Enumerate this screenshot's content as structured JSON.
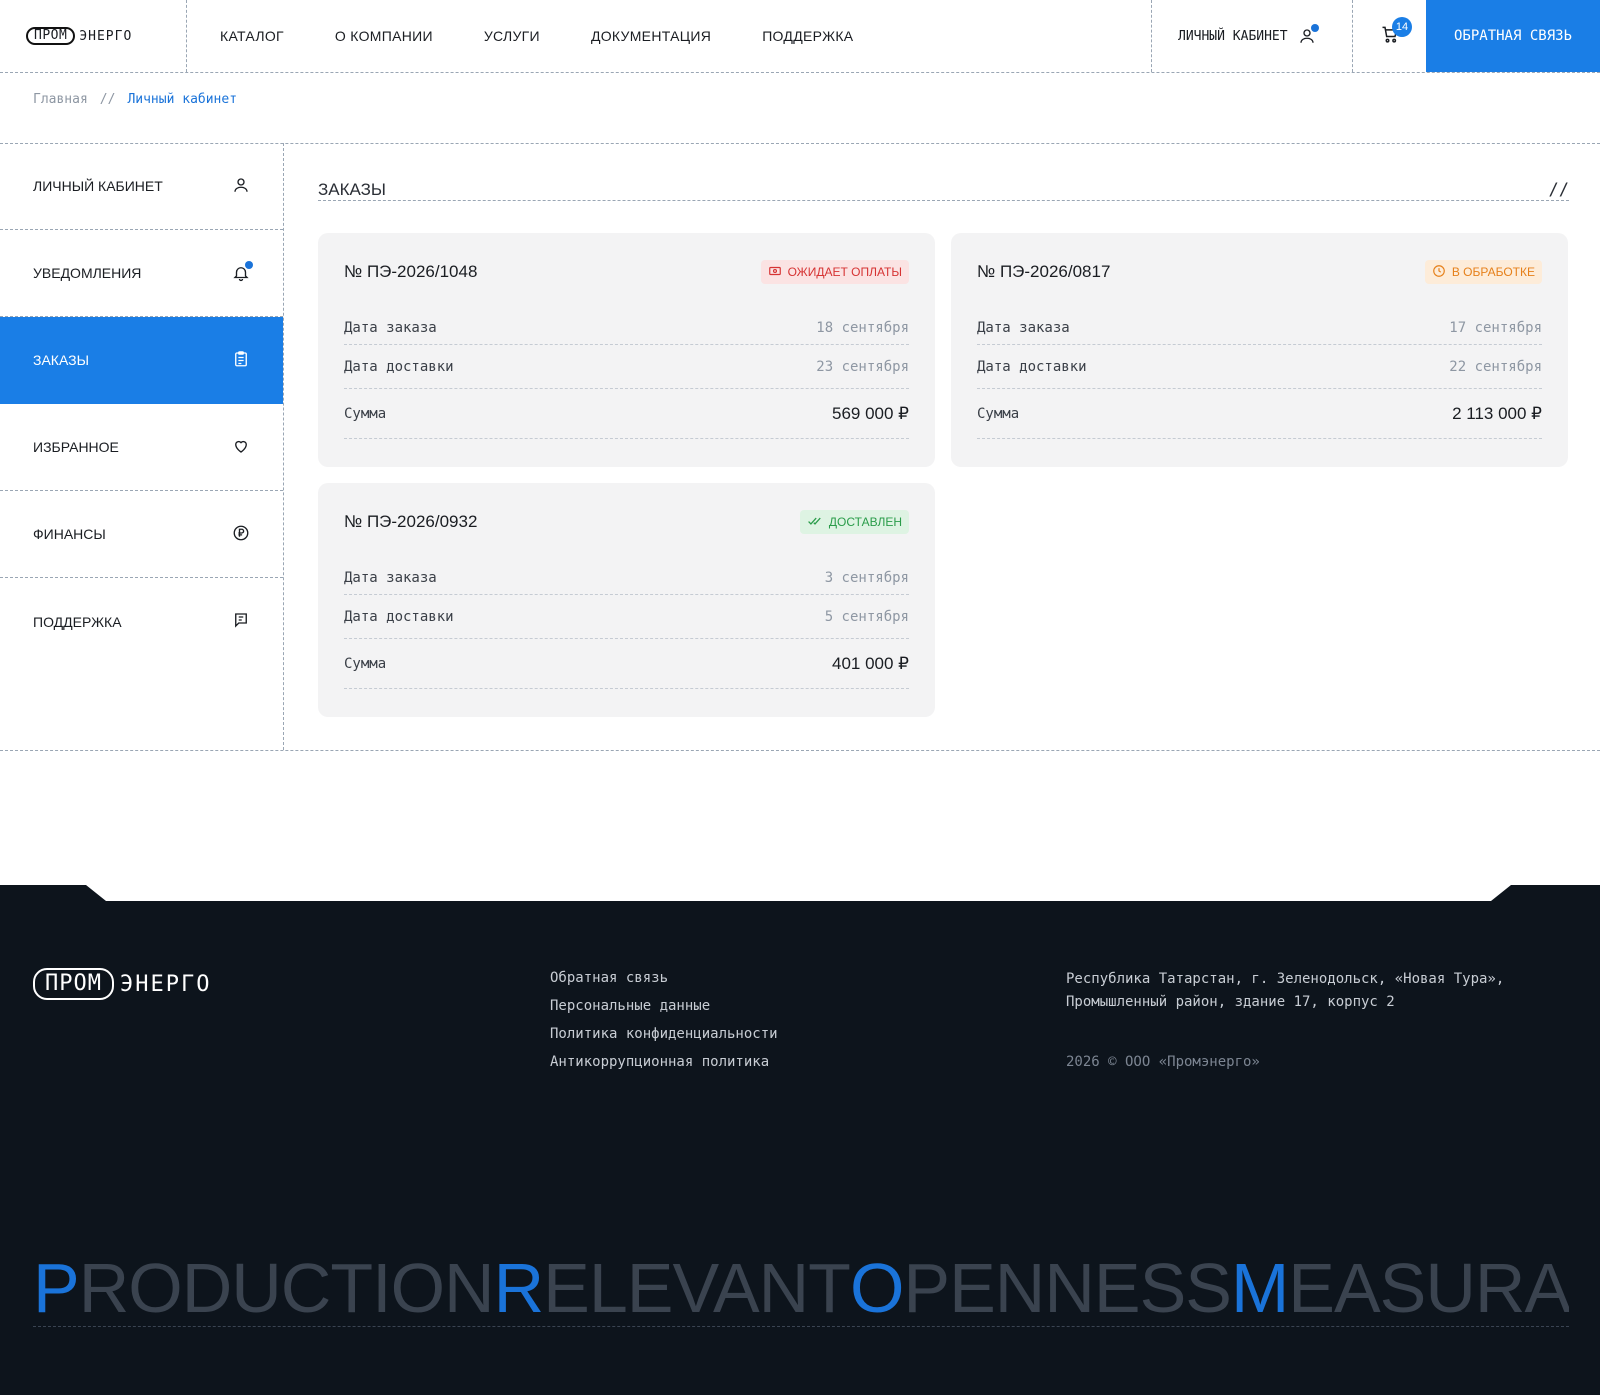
{
  "header": {
    "logo_pill": "ПРОМ",
    "logo_word": "ЭНЕРГО",
    "nav": [
      "Каталог",
      "О компании",
      "Услуги",
      "Документация",
      "Поддержка"
    ],
    "cabinet_label": "Личный кабинет",
    "cart_count": "14",
    "cta_label": "Обратная связь"
  },
  "breadcrumb": {
    "home": "Главная",
    "separator": "//",
    "current": "Личный кабинет"
  },
  "sidebar": {
    "items": [
      {
        "label": "Личный кабинет",
        "icon": "user-icon"
      },
      {
        "label": "Уведомления",
        "icon": "bell-icon"
      },
      {
        "label": "Заказы",
        "icon": "clipboard-icon"
      },
      {
        "label": "Избранное",
        "icon": "heart-icon"
      },
      {
        "label": "Финансы",
        "icon": "ruble-coin-icon"
      },
      {
        "label": "Поддержка",
        "icon": "chat-icon"
      }
    ],
    "active_index": 2
  },
  "main": {
    "title": "Заказы",
    "title_mark": "//",
    "orders": [
      {
        "number": "№ ПЭ-2026/1048",
        "status": "Ожидает оплаты",
        "status_color": "#d63333",
        "order_date_label": "Дата заказа",
        "order_date": "18 сентября",
        "delivery_date_label": "Дата доставки",
        "delivery_date": "23 сентября",
        "sum_label": "Сумма",
        "sum": "569 000 ₽"
      },
      {
        "number": "№ ПЭ-2026/0817",
        "status": "В обработке",
        "status_color": "#e6801a",
        "order_date_label": "Дата заказа",
        "order_date": "17 сентября",
        "delivery_date_label": "Дата доставки",
        "delivery_date": "22 сентября",
        "sum_label": "Сумма",
        "sum": "2 113 000 ₽"
      },
      {
        "number": "№ ПЭ-2026/0932",
        "status": "Доставлен",
        "status_color": "#2a9c4a",
        "order_date_label": "Дата заказа",
        "order_date": "3 сентября",
        "delivery_date_label": "Дата доставки",
        "delivery_date": "5 сентября",
        "sum_label": "Сумма",
        "sum": "401 000 ₽"
      }
    ]
  },
  "footer": {
    "logo_pill": "ПРОМ",
    "logo_word": "ЭНЕРГО",
    "links": [
      "Обратная связь",
      "Персональные данные",
      "Политика конфиденциальности",
      "Антикоррупционная политика"
    ],
    "address_line1": "Республика Татарстан, г. Зеленодольск, «Новая Тура»,",
    "address_line2": "Промышленный район, здание 17, корпус 2",
    "copyright": "2026 © ООО «Промэнерго»",
    "slogan": [
      {
        "accent": "P",
        "rest": "RODUCTION"
      },
      {
        "accent": "R",
        "rest": "ELEVANT"
      },
      {
        "accent": "O",
        "rest": "PENNESS"
      },
      {
        "accent": "M",
        "rest": "EASURABLE"
      }
    ]
  },
  "colors": {
    "accent": "#1a7ee6",
    "footer_bg": "#0d141c"
  }
}
